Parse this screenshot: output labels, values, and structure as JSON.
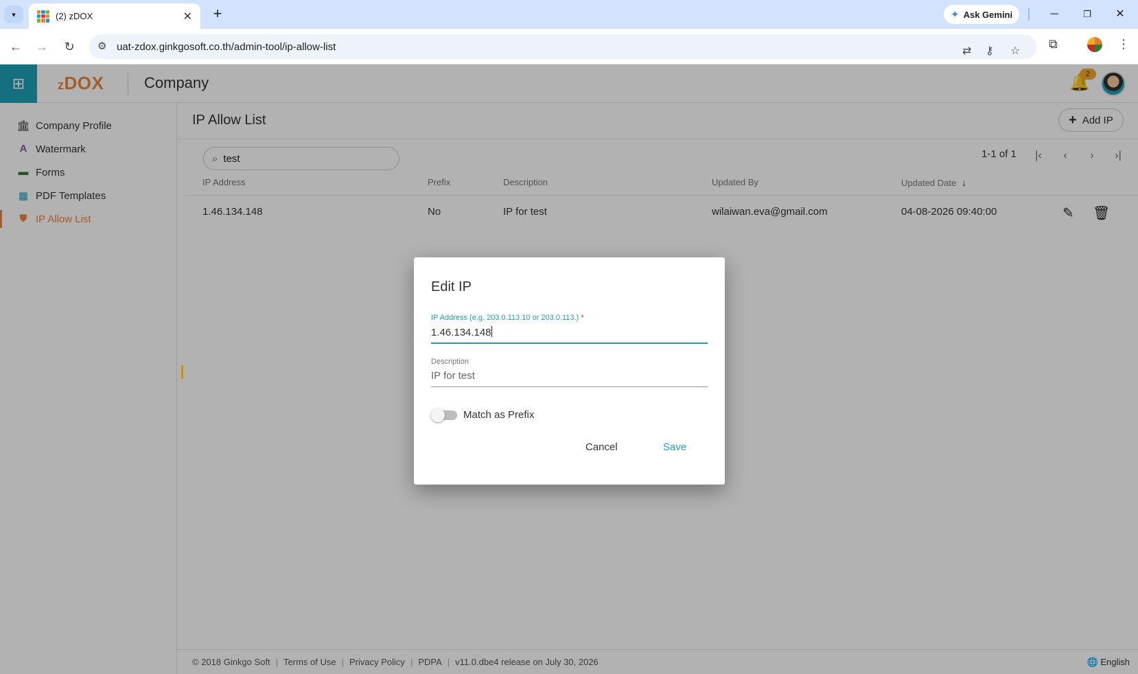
{
  "browser": {
    "tab_title": "(2) zDOX",
    "tab_close": "✕",
    "new_tab": "+",
    "gemini_label": "Ask Gemini",
    "url": "uat-zdox.ginkgosoft.co.th/admin-tool/ip-allow-list"
  },
  "header": {
    "logo_prefix": "z",
    "logo_main": "DOX",
    "title": "Company",
    "notification_count": "2"
  },
  "sidebar": {
    "items": [
      {
        "label": "Company Profile",
        "icon": "bank-icon"
      },
      {
        "label": "Watermark",
        "icon": "watermark-icon"
      },
      {
        "label": "Forms",
        "icon": "forms-icon"
      },
      {
        "label": "PDF Templates",
        "icon": "pdf-templates-icon"
      },
      {
        "label": "IP Allow List",
        "icon": "shield-icon",
        "active": true
      }
    ]
  },
  "main": {
    "page_title": "IP Allow List",
    "add_button": "Add IP",
    "search_value": "test",
    "pager_text": "1-1 of 1",
    "columns": [
      "IP Address",
      "Prefix",
      "Description",
      "Updated By",
      "Updated Date"
    ],
    "sort_indicator": "↓",
    "rows": [
      {
        "ip": "1.46.134.148",
        "prefix": "No",
        "description": "IP for test",
        "updated_by": "wilaiwan.eva@gmail.com",
        "updated_date": "04-08-2026 09:40:00"
      }
    ]
  },
  "footer": {
    "copyright": "© 2018 Ginkgo Soft",
    "terms": "Terms of Use",
    "privacy": "Privacy Policy",
    "pdpa": "PDPA",
    "version": "v11.0.dbe4 release on July 30, 2026",
    "language": "English"
  },
  "dialog": {
    "title": "Edit IP",
    "ip_label": "IP Address (e.g. 203.0.113.10 or 203.0.113.)",
    "required_mark": "*",
    "ip_value": "1.46.134.148",
    "description_label": "Description",
    "description_value": "IP for test",
    "match_prefix_label": "Match as Prefix",
    "match_prefix_enabled": false,
    "cancel_label": "Cancel",
    "save_label": "Save"
  },
  "colors": {
    "brand_teal": "#1f9fb5",
    "brand_orange": "#e8873a",
    "badge": "#f5a623"
  }
}
